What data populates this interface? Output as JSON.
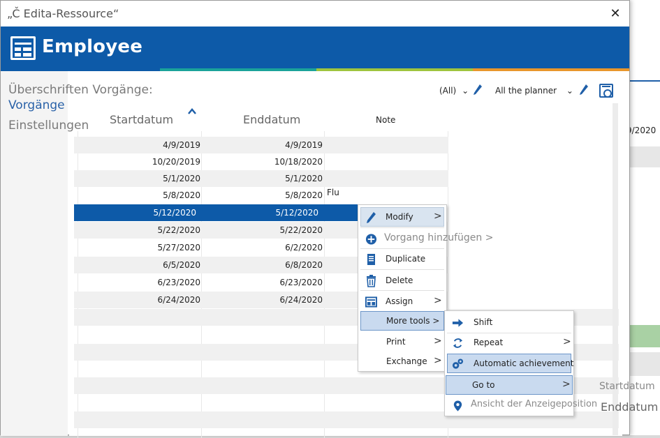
{
  "window": {
    "title": "„Č Edita-Ressource“",
    "close_glyph": "✕"
  },
  "header": {
    "title": "Employee"
  },
  "colors": {
    "brand": "#0d5aa8",
    "stripe_teal": "#1aa39a",
    "stripe_green": "#9fc43e",
    "stripe_orange": "#e8962b"
  },
  "left_nav": {
    "items": [
      {
        "label": "Überschriften Vorgänge:"
      },
      {
        "label": "Vorgänge"
      },
      {
        "label": "Einstellungen"
      }
    ]
  },
  "toolbar": {
    "filter1": "(All)",
    "filter2": "All the planner"
  },
  "table": {
    "columns": [
      "Startdatum",
      "Enddatum",
      "Note"
    ],
    "rows": [
      {
        "start": "4/9/2019",
        "end": "4/9/2019",
        "note": ""
      },
      {
        "start": "10/20/2019",
        "end": "10/18/2020",
        "note": ""
      },
      {
        "start": "5/1/2020",
        "end": "5/1/2020",
        "note": ""
      },
      {
        "start": "5/8/2020",
        "end": "5/8/2020",
        "note": "Flu"
      },
      {
        "start": "5/12/2020",
        "end": "5/12/2020",
        "note": ""
      },
      {
        "start": "5/22/2020",
        "end": "5/22/2020",
        "note": ""
      },
      {
        "start": "5/27/2020",
        "end": "6/2/2020",
        "note": ""
      },
      {
        "start": "6/5/2020",
        "end": "6/8/2020",
        "note": ""
      },
      {
        "start": "6/23/2020",
        "end": "6/23/2020",
        "note": ""
      },
      {
        "start": "6/24/2020",
        "end": "6/24/2020",
        "note": ""
      }
    ]
  },
  "context_menu": {
    "modify": "Modify",
    "add_process": "Vorgang hinzufügen >",
    "duplicate": "Duplicate",
    "delete": "Delete",
    "assign": "Assign",
    "more_tools": "More tools >",
    "print": "Print",
    "exchange": "Exchange"
  },
  "submenu": {
    "shift": "Shift",
    "repeat": "Repeat",
    "automatic_achievement": "Automatic achievement",
    "go_to": "Go to",
    "display_position": "Ansicht der Anzeigeposition"
  },
  "float_labels": {
    "startdatum": "Startdatum",
    "enddatum": "Enddatum"
  },
  "background": {
    "date": "9/2020"
  },
  "arrow_glyph": ">"
}
